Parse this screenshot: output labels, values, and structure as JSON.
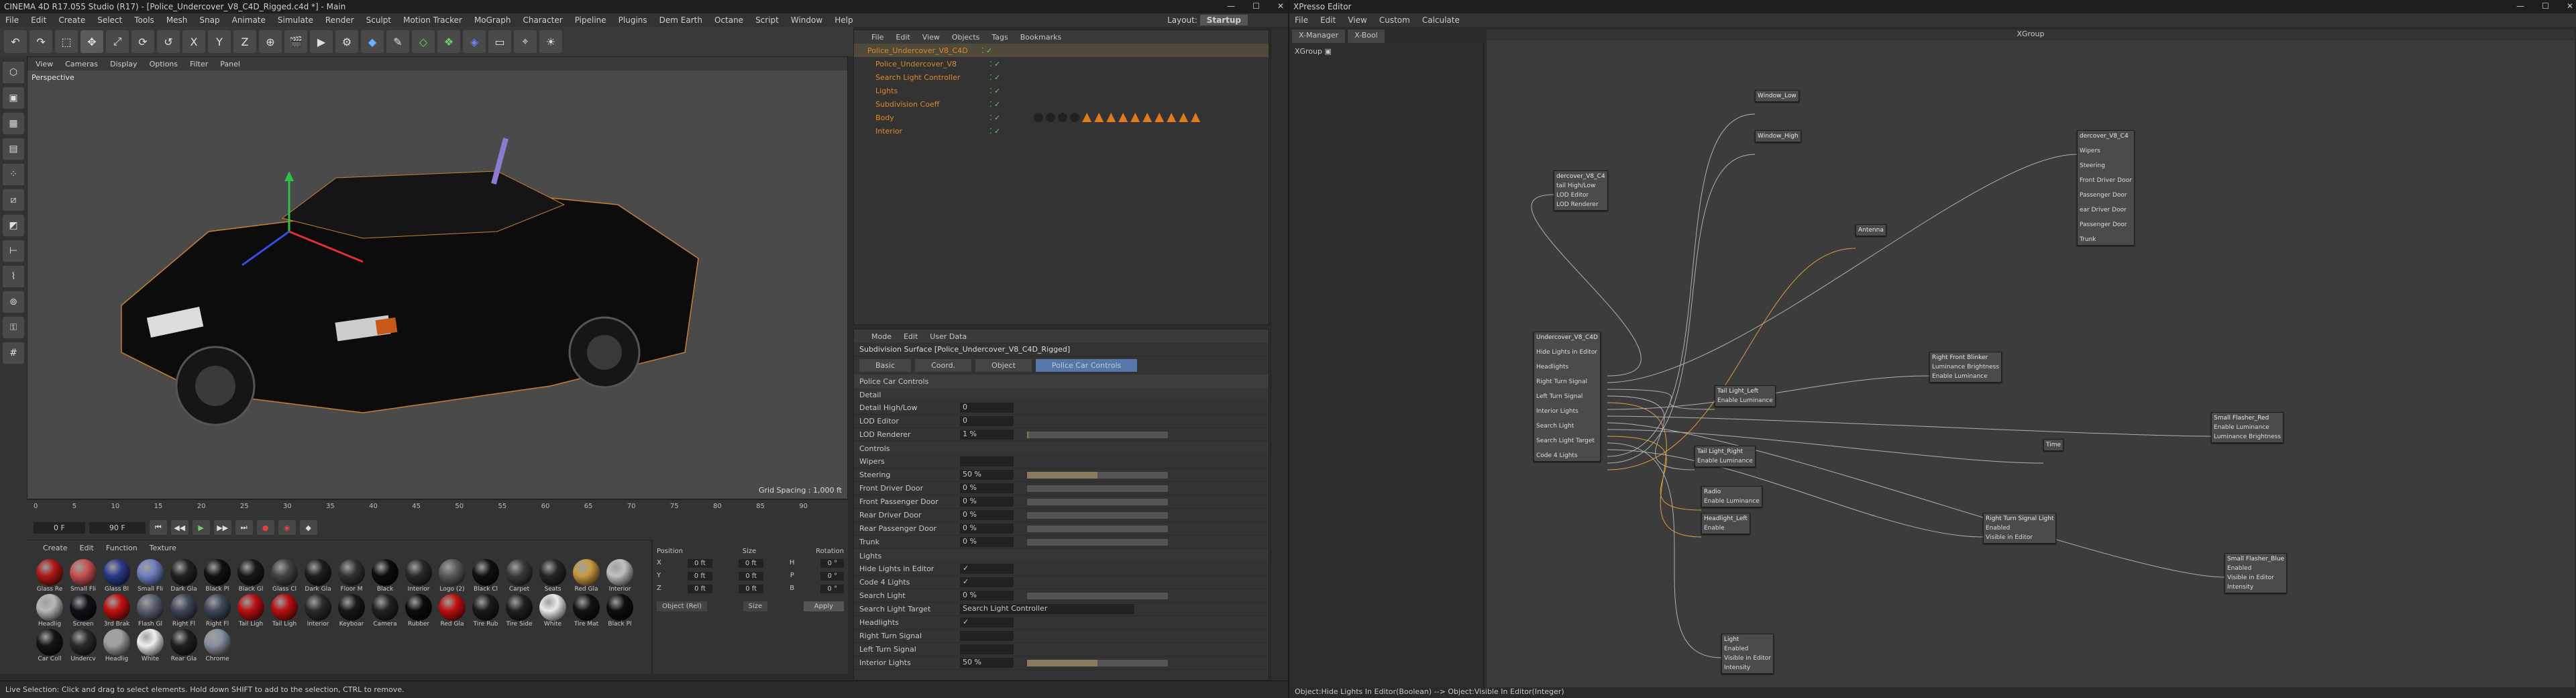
{
  "window": {
    "title": "CINEMA 4D R17.055 Studio (R17) - [Police_Undercover_V8_C4D_Rigged.c4d *] - Main",
    "xp_title": "XPresso Editor"
  },
  "menu": [
    "File",
    "Edit",
    "Create",
    "Select",
    "Tools",
    "Mesh",
    "Snap",
    "Animate",
    "Simulate",
    "Render",
    "Sculpt",
    "Motion Tracker",
    "MoGraph",
    "Character",
    "Pipeline",
    "Plugins",
    "Dem Earth",
    "Octane",
    "Script",
    "Window",
    "Help"
  ],
  "layout": {
    "label": "Layout:",
    "value": "Startup"
  },
  "viewport": {
    "menu": [
      "View",
      "Cameras",
      "Display",
      "Options",
      "Filter",
      "Panel"
    ],
    "label": "Perspective",
    "grid": "Grid Spacing : 1,000 ft"
  },
  "timeline": {
    "ticks": [
      "0",
      "5",
      "10",
      "15",
      "20",
      "25",
      "30",
      "35",
      "40",
      "45",
      "50",
      "55",
      "60",
      "65",
      "70",
      "75",
      "80",
      "85",
      "90"
    ],
    "start": "0 F",
    "end": "90 F",
    "current": "0 F"
  },
  "materials": {
    "menu": [
      "Create",
      "Edit",
      "Function",
      "Texture"
    ],
    "items": [
      "Glass Re",
      "Small Fli",
      "Glass Bl",
      "Small Fli",
      "Dark Gla",
      "Black Pl",
      "Black Gl",
      "Glass Cl",
      "Dark Gla",
      "Floor M",
      "Black",
      "Interior",
      "Logo (2)",
      "Black Cl",
      "Carpet",
      "Seats",
      "Red Gla",
      "Interior",
      "Headlig",
      "Screen",
      "3rd Brak",
      "Flash Gl",
      "Right Fl",
      "Right Fl",
      "Tail Ligh",
      "Tail Ligh",
      "Interior",
      "Keyboar",
      "Camera",
      "Rubber",
      "Red Gla",
      "Tire Rub",
      "Tire Side",
      "White",
      "Tire Mat",
      "Black Pl",
      "Car Coll",
      "Undercv",
      "Headlig",
      "White",
      "Rear Gla",
      "Chrome"
    ],
    "colors": [
      "#b01818",
      "#c85050",
      "#2a3a8a",
      "#7080c0",
      "#222",
      "#111",
      "#181818",
      "#444",
      "#1e1e1e",
      "#333",
      "#0c0c0c",
      "#2a2a2a",
      "#5a5a5a",
      "#101010",
      "#3a3a3a",
      "#262626",
      "#c89a40",
      "#c0c0c0",
      "#b8b8b8",
      "#101018",
      "#c01010",
      "#5a6070",
      "#404858",
      "#404858",
      "#b81010",
      "#b81010",
      "#2a2a2a",
      "#181818",
      "#222",
      "#0c0c0c",
      "#c01010",
      "#1a1a1a",
      "#202020",
      "#eaeaea",
      "#121212",
      "#0e0e0e",
      "#151515",
      "#2a2a2a",
      "#a0a0a0",
      "#f0f0f0",
      "#202020",
      "#8890a0"
    ]
  },
  "coords": {
    "headers": [
      "Position",
      "Size",
      "Rotation"
    ],
    "rows": [
      [
        "X",
        "0 ft",
        "0 ft",
        "H",
        "0 °"
      ],
      [
        "Y",
        "0 ft",
        "0 ft",
        "P",
        "0 °"
      ],
      [
        "Z",
        "0 ft",
        "0 ft",
        "B",
        "0 °"
      ]
    ],
    "mode": "Object (Rel)",
    "size_mode": "Size",
    "apply": "Apply"
  },
  "status": "Live Selection: Click and drag to select elements. Hold down SHIFT to add to the selection, CTRL to remove.",
  "objects": {
    "menu": [
      "File",
      "Edit",
      "View",
      "Objects",
      "Tags",
      "Bookmarks"
    ],
    "rows": [
      {
        "name": "Police_Undercover_V8_C4D",
        "cls": "omorange"
      },
      {
        "name": "Police_Undercover_V8",
        "cls": "omorange"
      },
      {
        "name": "Search Light Controller",
        "cls": "omorange"
      },
      {
        "name": "Lights",
        "cls": "omorange"
      },
      {
        "name": "Subdivision Coeff",
        "cls": "omorange"
      },
      {
        "name": "Body",
        "cls": "omorange"
      },
      {
        "name": "Interior",
        "cls": "omorange"
      }
    ]
  },
  "attributes": {
    "menu": [
      "Mode",
      "Edit",
      "User Data"
    ],
    "object_line": "Subdivision Surface [Police_Undercover_V8_C4D_Rigged]",
    "tabs": [
      "Basic",
      "Coord.",
      "Object",
      "Police Car Controls"
    ],
    "section": "Police Car Controls",
    "detail_head": "Detail",
    "detail": [
      {
        "label": "Detail High/Low",
        "val": "0"
      },
      {
        "label": "LOD Editor",
        "val": "0"
      },
      {
        "label": "LOD Renderer",
        "val": "1 %"
      }
    ],
    "controls_head": "Controls",
    "controls": [
      {
        "label": "Wipers",
        "val": ""
      },
      {
        "label": "Steering",
        "val": "50 %",
        "fill": 0.5
      },
      {
        "label": "Front Driver Door",
        "val": "0 %",
        "fill": 0
      },
      {
        "label": "Front Passenger Door",
        "val": "0 %",
        "fill": 0
      },
      {
        "label": "Rear Driver Door",
        "val": "0 %",
        "fill": 0
      },
      {
        "label": "Rear Passenger Door",
        "val": "0 %",
        "fill": 0
      },
      {
        "label": "Trunk",
        "val": "0 %",
        "fill": 0
      }
    ],
    "lights_head": "Lights",
    "lights": [
      {
        "label": "Hide Lights in Editor",
        "val": "✓"
      },
      {
        "label": "Code 4 Lights",
        "val": "✓"
      },
      {
        "label": "Search Light",
        "val": "0 %"
      },
      {
        "label": "Search Light Target",
        "val": "Search Light Controller"
      },
      {
        "label": "Headlights",
        "val": "✓"
      },
      {
        "label": "Right Turn Signal",
        "val": ""
      },
      {
        "label": "Left Turn Signal",
        "val": ""
      },
      {
        "label": "Interior Lights",
        "val": "50 %",
        "fill": 0.5
      }
    ]
  },
  "xpresso": {
    "menu": [
      "File",
      "Edit",
      "View",
      "Custom",
      "Calculate"
    ],
    "tabs": [
      "X-Manager",
      "X-Bool"
    ],
    "group": "XGroup",
    "canvas_title": "XGroup",
    "status": "Object:Hide Lights In Editor(Boolean) --> Object:Visible In Editor(Integer)",
    "nodes": [
      {
        "t": "Undercover_V8_C4D",
        "p": [
          "Hide Lights in Editor",
          "Headlights",
          "Right Turn Signal",
          "Left Turn Signal",
          "Interior Lights",
          "Search Light",
          "Search Light Target",
          "Code 4 Lights"
        ]
      },
      {
        "t": "dercover_V8_C4",
        "p": [
          "tail High/Low",
          "LOD Editor",
          "LOD Renderer"
        ]
      },
      {
        "t": "dercover_V8_C4",
        "p": [
          "Wipers",
          "Steering",
          "Front Driver Door",
          "Passenger Door",
          "ear Driver Door",
          "Passenger Door",
          "Trunk"
        ]
      },
      {
        "t": "Tail Light_Left",
        "p": [
          "Enable Luminance"
        ]
      },
      {
        "t": "Tail Light_Right",
        "p": [
          "Enable Luminance"
        ]
      },
      {
        "t": "Headlight_Left",
        "p": [
          "Enable"
        ]
      },
      {
        "t": "Right Front Blinker",
        "p": [
          "Luminance Brightness",
          "Enable Luminance"
        ]
      },
      {
        "t": "Small Flasher_Red",
        "p": [
          "Enable Luminance",
          "Luminance Brightness"
        ]
      },
      {
        "t": "Small Flasher_Blue",
        "p": [
          "Enabled",
          "Visible in Editor",
          "Intensity"
        ]
      },
      {
        "t": "Time",
        "p": []
      },
      {
        "t": "Radio",
        "p": [
          "Enable Luminance"
        ]
      },
      {
        "t": "Light",
        "p": [
          "Enabled",
          "Visible in Editor",
          "Intensity"
        ]
      },
      {
        "t": "Right Turn Signal Light",
        "p": [
          "Enabled",
          "Visible in Editor"
        ]
      },
      {
        "t": "Window_Low",
        "p": []
      },
      {
        "t": "Window_High",
        "p": []
      },
      {
        "t": "Antenna",
        "p": []
      }
    ]
  }
}
